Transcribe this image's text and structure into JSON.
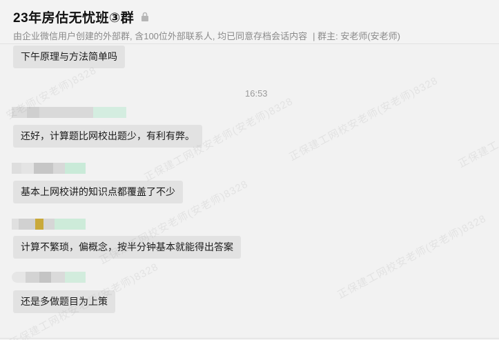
{
  "header": {
    "title": "23年房估无忧班③群",
    "subtitle": "由企业微信用户创建的外部群, 含100位外部联系人, 均已同意存档会话内容",
    "owner": "| 群主: 安老师(安老师)"
  },
  "messages": [
    {
      "text": "下午原理与方法简单吗"
    },
    {
      "timestamp": "16:53"
    },
    {
      "text": "还好，计算题比网校出题少，有利有弊。"
    },
    {
      "text": "基本上网校讲的知识点都覆盖了不少"
    },
    {
      "text": "计算不繁琐，偏概念，按半分钟基本就能得出答案"
    },
    {
      "text": "还是多做题目为上策"
    }
  ],
  "watermark": {
    "text_a": "正保建工网校安老师(安老师)8328",
    "text_b": "安老师(安老师)8328",
    "text_c": "正保建工"
  },
  "colors": {
    "background": "#f2f2f2",
    "bubble": "#e2e2e2",
    "subtitle": "#8a8a8a"
  }
}
